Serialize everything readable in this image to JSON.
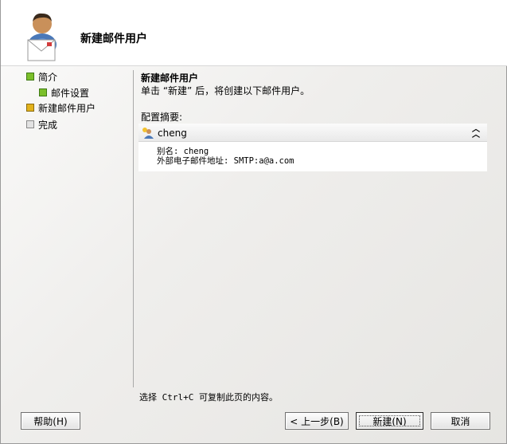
{
  "header": {
    "title": "新建邮件用户"
  },
  "nav": {
    "items": [
      {
        "label": "简介",
        "status": "completed"
      },
      {
        "label": "邮件设置",
        "status": "completed"
      },
      {
        "label": "新建邮件用户",
        "status": "current"
      },
      {
        "label": "完成",
        "status": "pending"
      }
    ]
  },
  "content": {
    "title": "新建邮件用户",
    "description": "单击 “新建” 后，将创建以下邮件用户。",
    "summary_label": "配置摘要:",
    "summary": {
      "name": "cheng",
      "alias_line": "别名: cheng",
      "address_line": "外部电子邮件地址: SMTP:a@a.com"
    },
    "hint": "选择 Ctrl+C 可复制此页的内容。"
  },
  "buttons": {
    "help": "帮助(H)",
    "back": "< 上一步(B)",
    "new": "新建(N)",
    "cancel": "取消"
  },
  "colors": {
    "completed": "#7bbf2a",
    "current": "#e2b21c",
    "pending": "#e2e2e2"
  }
}
